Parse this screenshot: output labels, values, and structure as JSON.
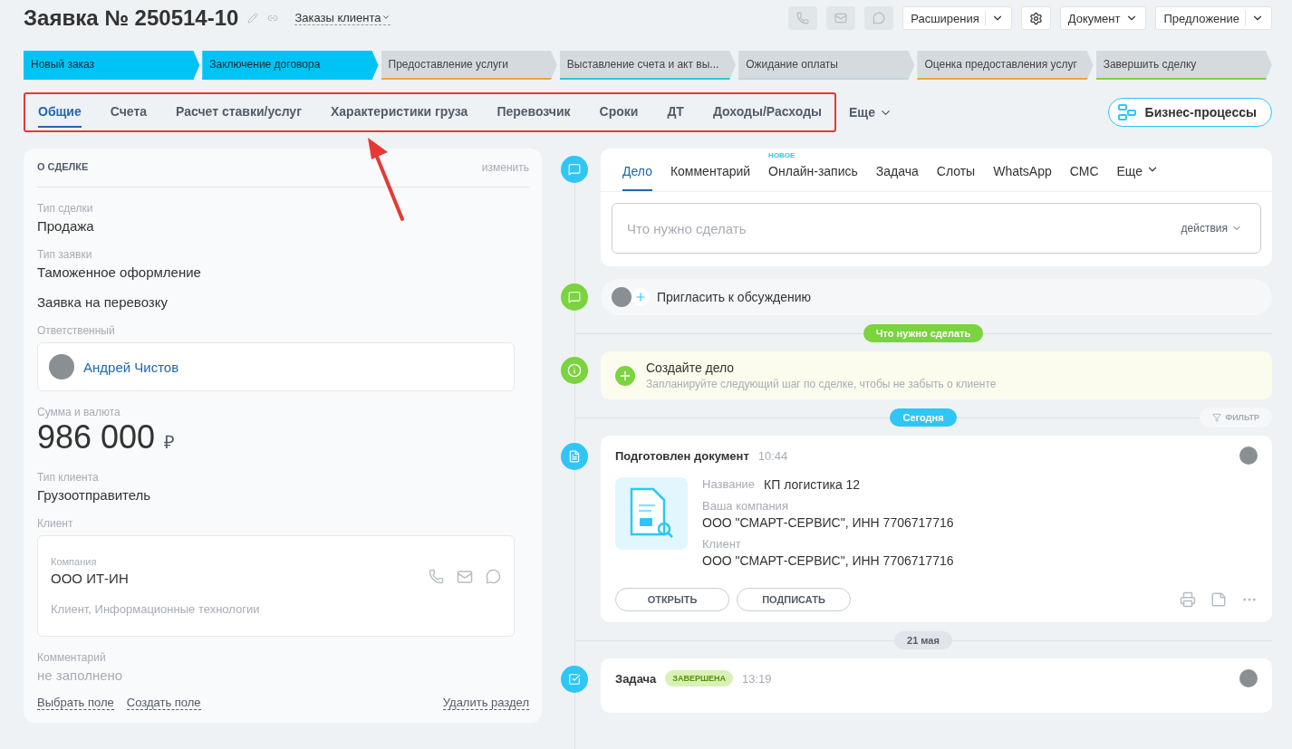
{
  "header": {
    "title": "Заявка № 250514-10",
    "category": "Заказы клиента",
    "buttons": [
      {
        "label": "Расширения",
        "split": true
      },
      {
        "label": "Документ",
        "split": false
      },
      {
        "label": "Предложение",
        "split": true
      }
    ]
  },
  "stages": [
    {
      "label": "Новый заказ",
      "done": true,
      "color": "#00c3f5"
    },
    {
      "label": "Заключение договора",
      "done": true,
      "color": "#00c3f5"
    },
    {
      "label": "Предоставление услуги",
      "done": false,
      "color": "#f0a43b"
    },
    {
      "label": "Выставление счета и акт вы...",
      "done": false,
      "color": "#2fc6d8"
    },
    {
      "label": "Ожидание оплаты",
      "done": false,
      "color": "#c4d3dc"
    },
    {
      "label": "Оценка предоставления услуг",
      "done": false,
      "color": "#f0a43b"
    },
    {
      "label": "Завершить сделку",
      "done": false,
      "color": "#7bd33e"
    }
  ],
  "tabs": [
    {
      "label": "Общие",
      "selected": true
    },
    {
      "label": "Счета",
      "selected": false
    },
    {
      "label": "Расчет ставки/услуг",
      "selected": false
    },
    {
      "label": "Характеристики груза",
      "selected": false
    },
    {
      "label": "Перевозчик",
      "selected": false
    },
    {
      "label": "Сроки",
      "selected": false
    },
    {
      "label": "ДТ",
      "selected": false
    },
    {
      "label": "Доходы/Расходы",
      "selected": false
    }
  ],
  "tabs_more": "Еще",
  "business_processes": "Бизнес-процессы",
  "deal": {
    "title": "О СДЕЛКЕ",
    "edit": "изменить",
    "fields": [
      {
        "kind": "text",
        "label": "Тип сделки",
        "value": "Продажа"
      },
      {
        "kind": "text",
        "label": "Тип заявки",
        "value": "Таможенное оформление"
      },
      {
        "kind": "plain",
        "value": "Заявка на перевозку"
      },
      {
        "kind": "user",
        "label": "Ответственный",
        "value": "Андрей Чистов"
      },
      {
        "kind": "money",
        "label": "Сумма и валюта",
        "value": "986 000",
        "currency": "₽"
      },
      {
        "kind": "text",
        "label": "Тип клиента",
        "value": "Грузоотправитель"
      },
      {
        "kind": "client",
        "label": "Клиент",
        "caption": "Компания",
        "value": "ООО ИТ-ИН",
        "note": "Клиент, Информационные технологии"
      },
      {
        "kind": "empty",
        "label": "Комментарий",
        "value": "не заполнено"
      }
    ],
    "links": [
      "Выбрать поле",
      "Создать поле"
    ],
    "delete": "Удалить раздел"
  },
  "composer": {
    "tabs": [
      {
        "label": "Дело",
        "selected": true
      },
      {
        "label": "Комментарий",
        "selected": false
      },
      {
        "label": "Онлайн-запись",
        "selected": false,
        "badge": "НОВОЕ"
      },
      {
        "label": "Задача",
        "selected": false
      },
      {
        "label": "Слоты",
        "selected": false
      },
      {
        "label": "WhatsApp",
        "selected": false
      },
      {
        "label": "СМС",
        "selected": false
      }
    ],
    "more": "Еще",
    "placeholder": "Что нужно сделать",
    "actions": "действия"
  },
  "invite": "Пригласить к обсуждению",
  "todo_divider": "Что нужно сделать",
  "create": {
    "title": "Создайте дело",
    "hint": "Запланируйте следующий шаг по сделке, чтобы не забыть о клиенте"
  },
  "today_divider": "Сегодня",
  "filter": "ФИЛЬТР",
  "document": {
    "title": "Подготовлен документ",
    "time": "10:44",
    "rows": [
      {
        "label": "Название",
        "value": "КП логистика 12",
        "inline": true
      },
      {
        "label": "Ваша компания",
        "value": "ООО \"СМАРТ-СЕРВИС\", ИНН 7706717716",
        "inline": false
      },
      {
        "label": "Клиент",
        "value": "ООО \"СМАРТ-СЕРВИС\", ИНН 7706717716",
        "inline": false
      }
    ],
    "buttons": [
      "ОТКРЫТЬ",
      "ПОДПИСАТЬ"
    ]
  },
  "date_divider": "21 мая",
  "task": {
    "title": "Задача",
    "status": "ЗАВЕРШЕНА",
    "time": "13:19"
  }
}
